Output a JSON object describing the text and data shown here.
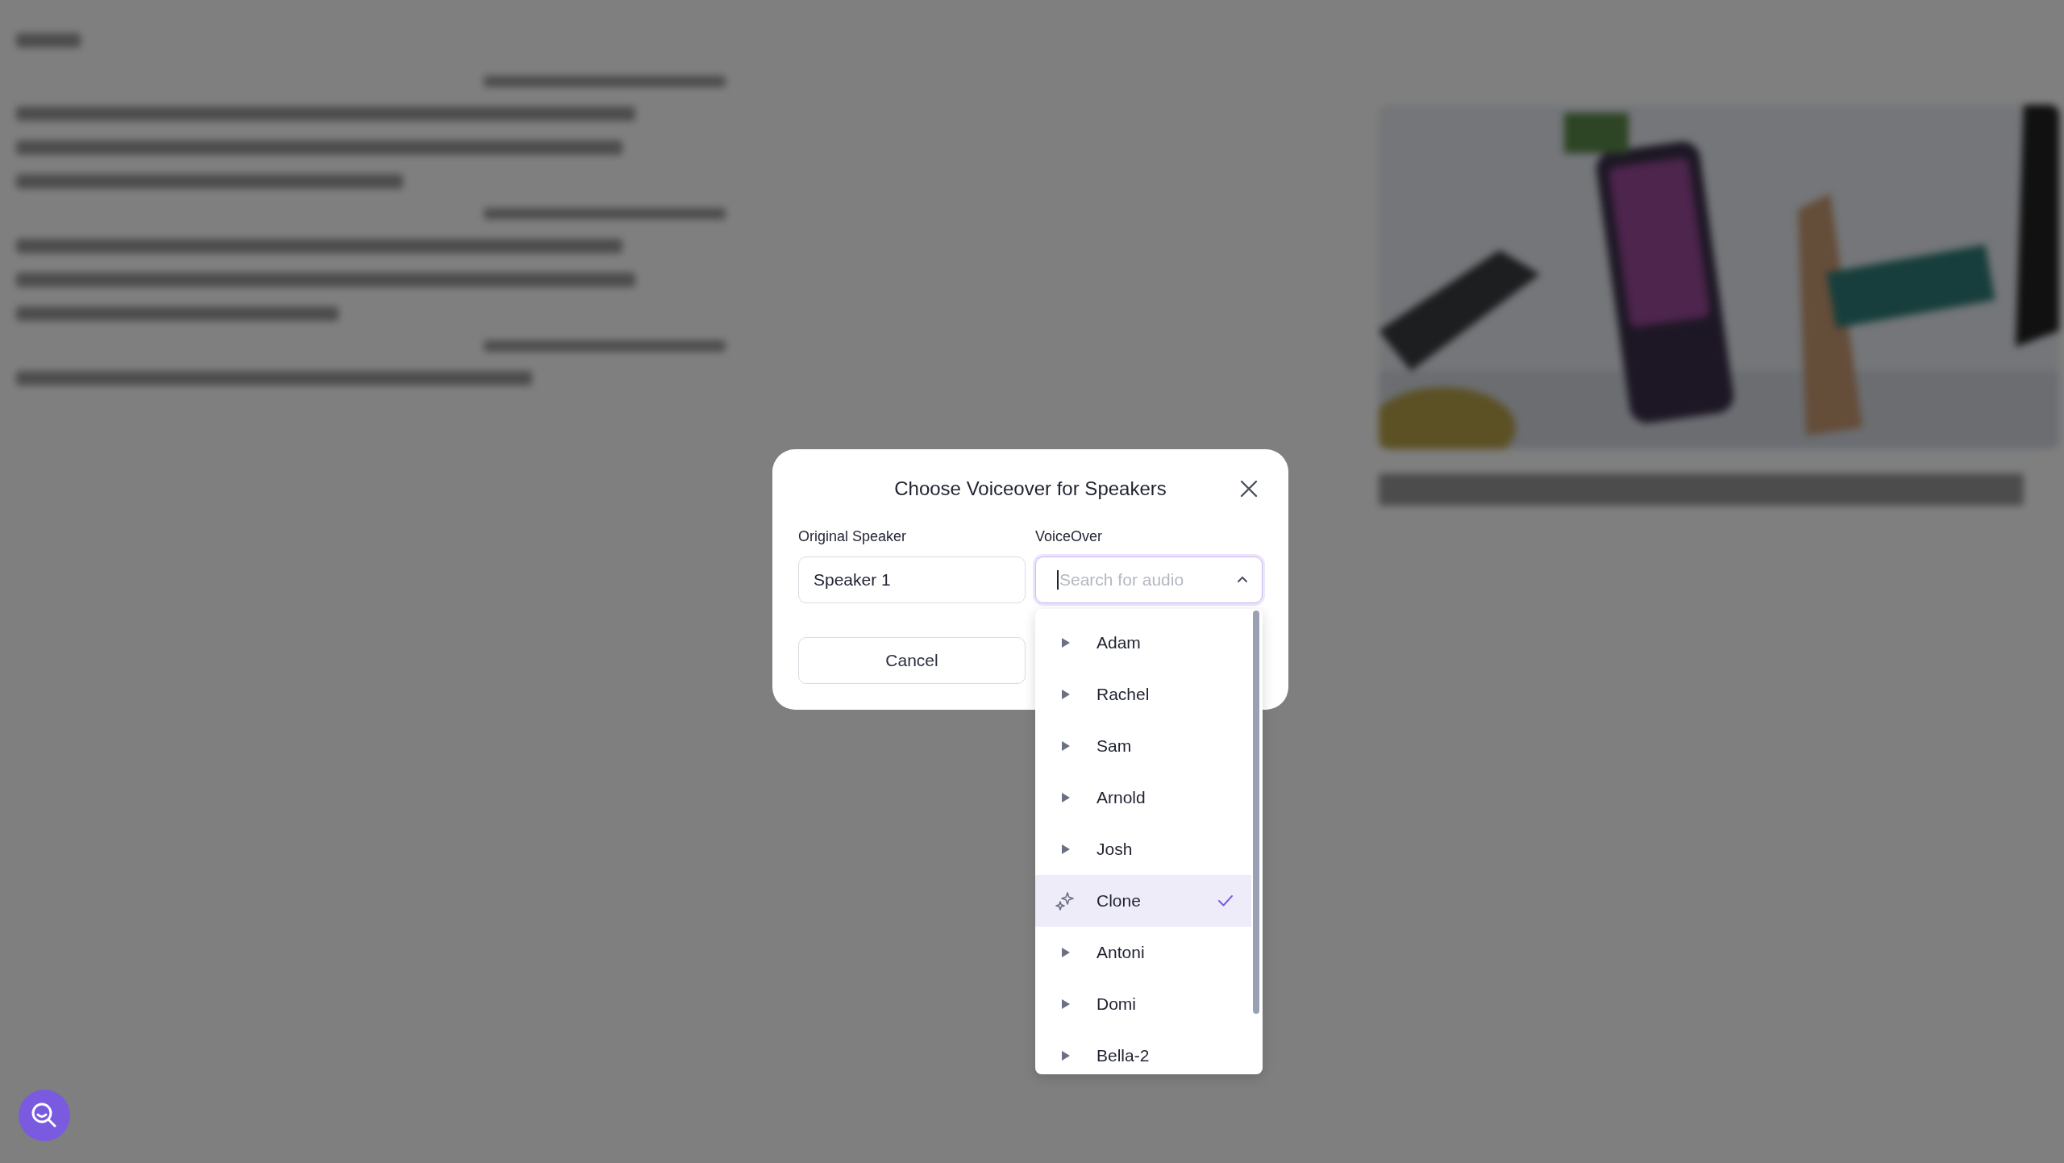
{
  "dialog": {
    "title": "Choose Voiceover for Speakers",
    "original_speaker": {
      "label": "Original Speaker",
      "value": "Speaker 1"
    },
    "voiceover": {
      "label": "VoiceOver",
      "placeholder": "Search for audio",
      "expanded": true
    },
    "cancel_button": "Cancel",
    "options": [
      {
        "label": "Adam",
        "kind": "voice",
        "selected": false
      },
      {
        "label": "Rachel",
        "kind": "voice",
        "selected": false
      },
      {
        "label": "Sam",
        "kind": "voice",
        "selected": false
      },
      {
        "label": "Arnold",
        "kind": "voice",
        "selected": false
      },
      {
        "label": "Josh",
        "kind": "voice",
        "selected": false
      },
      {
        "label": "Clone",
        "kind": "clone",
        "selected": true
      },
      {
        "label": "Antoni",
        "kind": "voice",
        "selected": false
      },
      {
        "label": "Domi",
        "kind": "voice",
        "selected": false
      },
      {
        "label": "Bella-2",
        "kind": "voice",
        "selected": false
      }
    ]
  }
}
